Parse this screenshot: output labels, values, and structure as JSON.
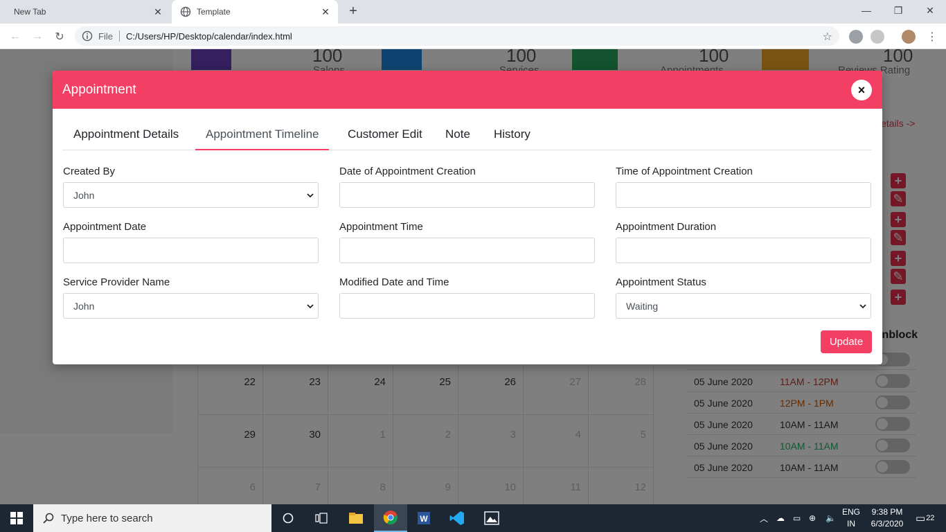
{
  "browser": {
    "tabs": [
      {
        "label": "New Tab"
      },
      {
        "label": "Template"
      }
    ],
    "new_tab_icon": "plus-icon",
    "address": {
      "scheme_label": "File",
      "url": "C:/Users/HP/Desktop/calendar/index.html"
    }
  },
  "page_background": {
    "stats": [
      {
        "value": "100",
        "label": "Salons",
        "color": "#6a3fbf"
      },
      {
        "value": "100",
        "label": "Services",
        "color": "#1e88e5"
      },
      {
        "value": "100",
        "label": "Appointments",
        "color": "#26a65b"
      },
      {
        "value": "100",
        "label": "Reviews Rating",
        "color": "#f5a623"
      }
    ],
    "details_link": "Details ->",
    "unblock_header": "Unblock",
    "calendar_rows": [
      [
        "22",
        "23",
        "24",
        "25",
        "26",
        "27",
        "28"
      ],
      [
        "29",
        "30",
        "1",
        "2",
        "3",
        "4",
        "5"
      ],
      [
        "6",
        "7",
        "8",
        "9",
        "10",
        "11",
        "12"
      ]
    ],
    "slots": [
      {
        "date": "05 June 2020",
        "time": "11AM - 12PM",
        "color": "#c0392b"
      },
      {
        "date": "05 June 2020",
        "time": "12PM - 1PM",
        "color": "#d35400"
      },
      {
        "date": "05 June 2020",
        "time": "10AM - 11AM",
        "color": "#333333"
      },
      {
        "date": "05 June 2020",
        "time": "10AM - 11AM",
        "color": "#27ae60"
      },
      {
        "date": "05 June 2020",
        "time": "10AM - 11AM",
        "color": "#333333"
      }
    ]
  },
  "modal": {
    "title": "Appointment",
    "close_label": "×",
    "tabs": [
      {
        "label": "Appointment Details"
      },
      {
        "label": "Appointment Timeline",
        "active": true
      },
      {
        "label": "Customer Edit"
      },
      {
        "label": "Note"
      },
      {
        "label": "History"
      }
    ],
    "fields": {
      "created_by": {
        "label": "Created By",
        "value": "John"
      },
      "date_of_creation": {
        "label": "Date of Appointment Creation",
        "value": ""
      },
      "time_of_creation": {
        "label": "Time of Appointment Creation",
        "value": ""
      },
      "appointment_date": {
        "label": "Appointment Date",
        "value": ""
      },
      "appointment_time": {
        "label": "Appointment Time",
        "value": ""
      },
      "appointment_duration": {
        "label": "Appointment Duration",
        "value": ""
      },
      "service_provider": {
        "label": "Service Provider Name",
        "value": "John"
      },
      "modified": {
        "label": "Modified Date and Time",
        "value": ""
      },
      "status": {
        "label": "Appointment Status",
        "value": "Waiting"
      }
    },
    "update_label": "Update",
    "accent_color": "#f23f63"
  },
  "taskbar": {
    "search_placeholder": "Type here to search",
    "lang_top": "ENG",
    "lang_bottom": "IN",
    "time": "9:38 PM",
    "date": "6/3/2020",
    "notifications": "22"
  }
}
